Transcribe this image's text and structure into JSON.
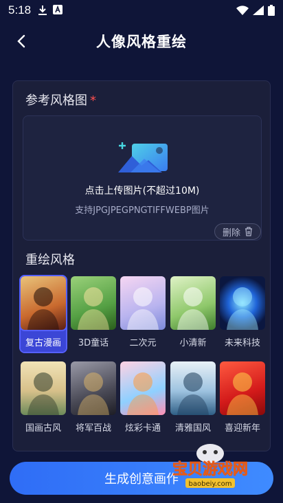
{
  "status": {
    "time": "5:18"
  },
  "header": {
    "title": "人像风格重绘"
  },
  "reference": {
    "label": "参考风格图",
    "required_mark": "*",
    "upload_text": "点击上传图片(不超过10M)",
    "support_text": "支持JPGJPEGPNGTIFFWEBP图片",
    "delete_label": "删除"
  },
  "styles": {
    "label": "重绘风格",
    "items": [
      {
        "name": "复古漫画",
        "selected": true
      },
      {
        "name": "3D童话",
        "selected": false
      },
      {
        "name": "二次元",
        "selected": false
      },
      {
        "name": "小清新",
        "selected": false
      },
      {
        "name": "未来科技",
        "selected": false
      },
      {
        "name": "国画古风",
        "selected": false
      },
      {
        "name": "将军百战",
        "selected": false
      },
      {
        "name": "炫彩卡通",
        "selected": false
      },
      {
        "name": "清雅国风",
        "selected": false
      },
      {
        "name": "喜迎新年",
        "selected": false
      }
    ]
  },
  "actions": {
    "generate_label": "生成创意画作"
  },
  "watermark": {
    "text": "宝贝游戏网",
    "url_text": "baobeiy.com"
  },
  "colors": {
    "accent": "#3f6df6",
    "background": "#0f1538",
    "required": "#ff4f4f"
  }
}
